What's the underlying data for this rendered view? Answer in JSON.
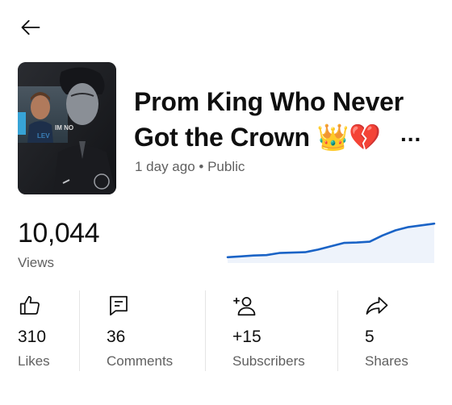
{
  "header": {
    "back_icon": "arrow-left-icon"
  },
  "video": {
    "thumbnail_text": "IM NO",
    "title_line1": "Prom King Who Never",
    "title_line2": "Got the Crown 👑💔",
    "more": "...",
    "meta": "1 day ago • Public"
  },
  "views": {
    "count": "10,044",
    "label": "Views",
    "trend": [
      0.1,
      0.12,
      0.14,
      0.15,
      0.2,
      0.21,
      0.22,
      0.28,
      0.36,
      0.44,
      0.45,
      0.47,
      0.62,
      0.74,
      0.82,
      0.86,
      0.9
    ],
    "color": "#1a63c6"
  },
  "stats": [
    {
      "icon": "thumbs-up-icon",
      "value": "310",
      "label": "Likes"
    },
    {
      "icon": "comment-icon",
      "value": "36",
      "label": "Comments"
    },
    {
      "icon": "add-person-icon",
      "value": "+15",
      "label": "Subscribers"
    },
    {
      "icon": "share-icon",
      "value": "5",
      "label": "Shares"
    }
  ]
}
